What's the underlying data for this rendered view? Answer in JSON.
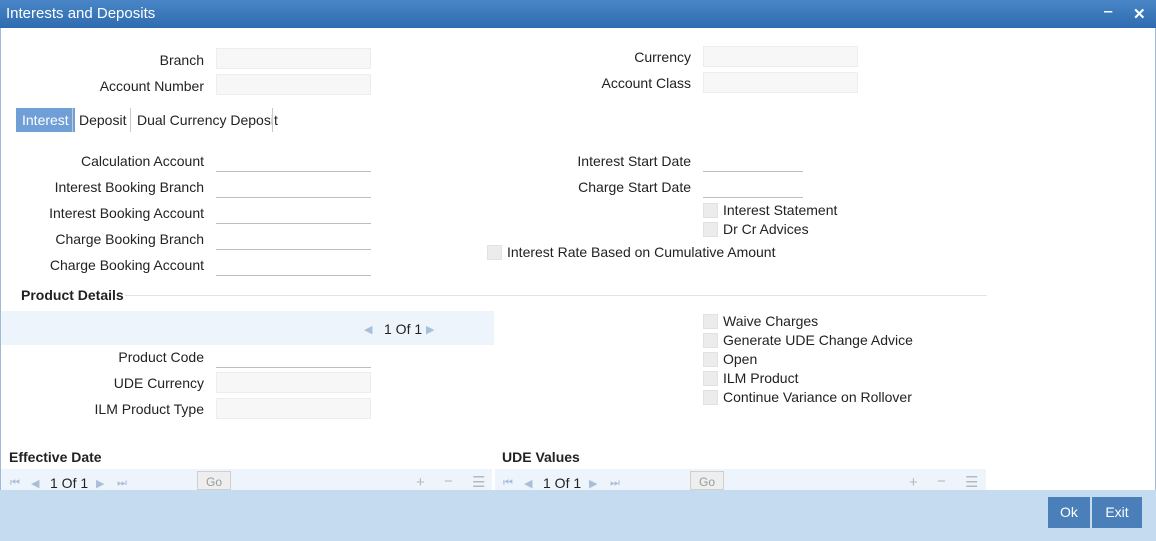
{
  "window": {
    "title": "Interests and Deposits",
    "minimize_icon": "minimize-icon",
    "close_icon": "close-icon"
  },
  "header": {
    "branch_label": "Branch",
    "branch_value": "",
    "account_number_label": "Account Number",
    "account_number_value": "",
    "currency_label": "Currency",
    "currency_value": "",
    "account_class_label": "Account Class",
    "account_class_value": ""
  },
  "tabs": [
    {
      "label": "Interest",
      "active": true
    },
    {
      "label": "Deposit",
      "active": false
    },
    {
      "label": "Dual Currency Deposit",
      "active": false
    }
  ],
  "interest": {
    "calculation_account_label": "Calculation Account",
    "interest_booking_branch_label": "Interest Booking Branch",
    "interest_booking_account_label": "Interest Booking Account",
    "charge_booking_branch_label": "Charge Booking Branch",
    "charge_booking_account_label": "Charge Booking Account",
    "interest_start_date_label": "Interest Start Date",
    "charge_start_date_label": "Charge Start Date",
    "interest_statement_label": "Interest Statement",
    "dr_cr_advices_label": "Dr Cr Advices",
    "rate_cumulative_label": "Interest Rate Based on Cumulative Amount"
  },
  "product_details": {
    "title": "Product Details",
    "pager": "1 Of 1",
    "product_code_label": "Product Code",
    "ude_currency_label": "UDE Currency",
    "ilm_product_type_label": "ILM Product Type",
    "waive_charges_label": "Waive Charges",
    "generate_ude_label": "Generate UDE Change Advice",
    "open_label": "Open",
    "ilm_product_label": "ILM Product",
    "continue_variance_label": "Continue Variance on Rollover"
  },
  "effective_date": {
    "title": "Effective Date",
    "pager": "1 Of 1",
    "go_label": "Go"
  },
  "ude_values": {
    "title": "UDE Values",
    "pager": "1 Of 1",
    "go_label": "Go"
  },
  "footer": {
    "ok_label": "Ok",
    "exit_label": "Exit"
  },
  "colors": {
    "title_bar": "#2e6bb0",
    "active_tab": "#6f9fd6",
    "footer": "#c5dbef",
    "button": "#4a7fb9"
  }
}
